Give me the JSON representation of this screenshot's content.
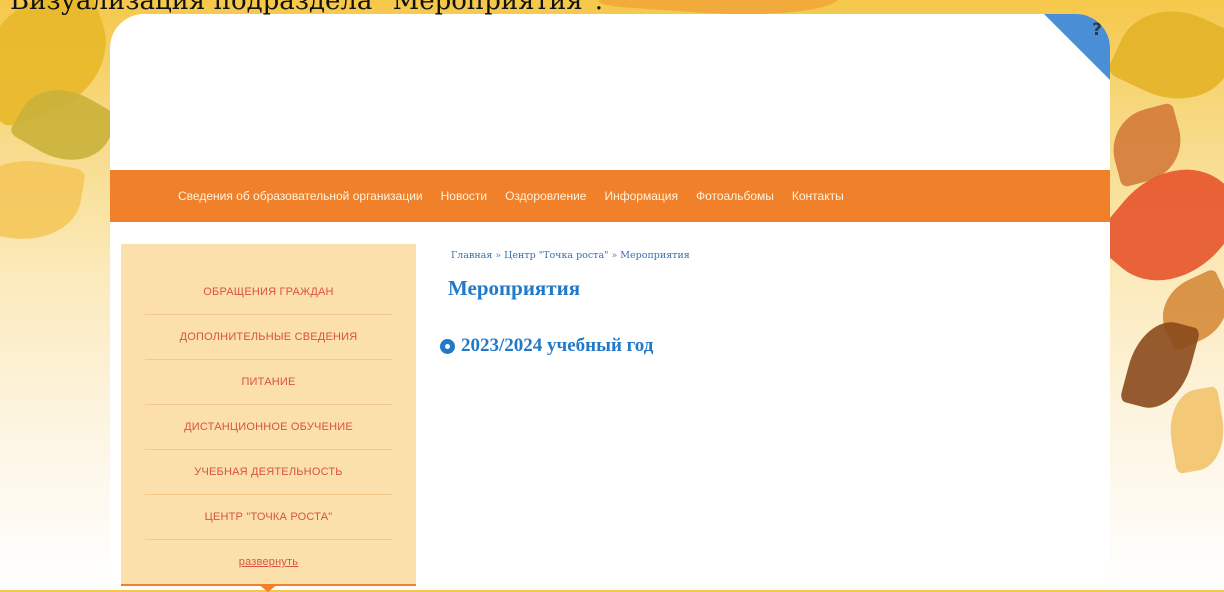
{
  "caption": "Визуализация подраздела \"Мероприятия\".",
  "help_button": {
    "label": "?"
  },
  "topnav": {
    "items": [
      {
        "label": "Сведения об образовательной организации"
      },
      {
        "label": "Новости"
      },
      {
        "label": "Оздоровление"
      },
      {
        "label": "Информация"
      },
      {
        "label": "Фотоальбомы"
      },
      {
        "label": "Контакты"
      }
    ]
  },
  "sidebar": {
    "items": [
      {
        "label": "ОБРАЩЕНИЯ ГРАЖДАН"
      },
      {
        "label": "ДОПОЛНИТЕЛЬНЫЕ СВЕДЕНИЯ"
      },
      {
        "label": "ПИТАНИЕ"
      },
      {
        "label": "ДИСТАНЦИОННОЕ ОБУЧЕНИЕ"
      },
      {
        "label": "УЧЕБНАЯ ДЕЯТЕЛЬНОСТЬ"
      },
      {
        "label": "ЦЕНТР \"ТОЧКА РОСТА\""
      }
    ],
    "expand_label": "развернуть"
  },
  "breadcrumb": {
    "home": "Главная",
    "parent": "Центр \"Точка роста\"",
    "current": "Мероприятия",
    "separator": "»"
  },
  "main": {
    "title": "Мероприятия",
    "items": [
      {
        "label": "2023/2024 учебный год"
      }
    ]
  },
  "colors": {
    "nav_orange": "#f0812a",
    "sidebar_bg": "#fbe0ab",
    "sidebar_text": "#d8543b",
    "link_blue": "#2179c9",
    "help_corner": "#4a8fd6"
  },
  "icons": {
    "help": "question-mark-icon",
    "list_bullet": "circle-bullet-icon"
  }
}
